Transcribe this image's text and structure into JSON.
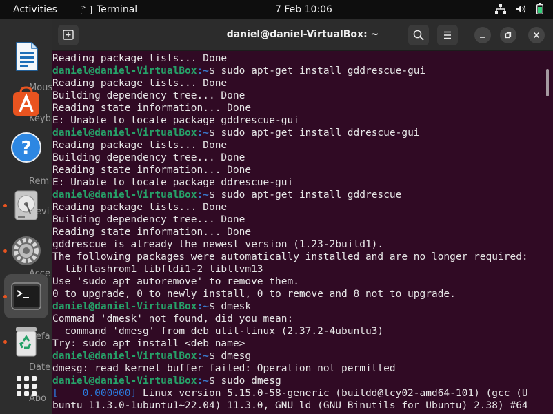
{
  "topbar": {
    "activities": "Activities",
    "app_name": "Terminal",
    "clock": "7 Feb  10:06"
  },
  "dock": {
    "background_labels": [
      "Mous",
      "Keyb",
      "Rem",
      "Devi",
      "Acce",
      "Defa",
      "Date",
      "Abo"
    ],
    "items": [
      {
        "name": "libreoffice-writer-icon"
      },
      {
        "name": "app-center-icon"
      },
      {
        "name": "help-icon"
      },
      {
        "name": "disks-icon"
      },
      {
        "name": "settings-icon"
      },
      {
        "name": "terminal-icon"
      },
      {
        "name": "trash-icon"
      },
      {
        "name": "show-apps-icon"
      }
    ]
  },
  "window": {
    "title": "daniel@daniel-VirtualBox: ~"
  },
  "terminal": {
    "prompt_user": "daniel@daniel-VirtualBox",
    "prompt_path": ":~",
    "prompt_symbol": "$ ",
    "lines": [
      {
        "type": "out",
        "text": "Reading package lists... Done"
      },
      {
        "type": "cmd",
        "text": "sudo apt-get install gddrescue-gui"
      },
      {
        "type": "out",
        "text": "Reading package lists... Done"
      },
      {
        "type": "out",
        "text": "Building dependency tree... Done"
      },
      {
        "type": "out",
        "text": "Reading state information... Done"
      },
      {
        "type": "out",
        "text": "E: Unable to locate package gddrescue-gui"
      },
      {
        "type": "cmd",
        "text": "sudo apt-get install ddrescue-gui"
      },
      {
        "type": "out",
        "text": "Reading package lists... Done"
      },
      {
        "type": "out",
        "text": "Building dependency tree... Done"
      },
      {
        "type": "out",
        "text": "Reading state information... Done"
      },
      {
        "type": "out",
        "text": "E: Unable to locate package ddrescue-gui"
      },
      {
        "type": "cmd",
        "text": "sudo apt-get install gddrescue"
      },
      {
        "type": "out",
        "text": "Reading package lists... Done"
      },
      {
        "type": "out",
        "text": "Building dependency tree... Done"
      },
      {
        "type": "out",
        "text": "Reading state information... Done"
      },
      {
        "type": "out",
        "text": "gddrescue is already the newest version (1.23-2build1)."
      },
      {
        "type": "out",
        "text": "The following packages were automatically installed and are no longer required:"
      },
      {
        "type": "out",
        "text": "  libflashrom1 libftdi1-2 libllvm13"
      },
      {
        "type": "out",
        "text": "Use 'sudo apt autoremove' to remove them."
      },
      {
        "type": "out",
        "text": "0 to upgrade, 0 to newly install, 0 to remove and 8 not to upgrade."
      },
      {
        "type": "cmd",
        "text": "dmesk"
      },
      {
        "type": "out",
        "text": "Command 'dmesk' not found, did you mean:"
      },
      {
        "type": "out",
        "text": "  command 'dmesg' from deb util-linux (2.37.2-4ubuntu3)"
      },
      {
        "type": "out",
        "text": "Try: sudo apt install <deb name>"
      },
      {
        "type": "cmd",
        "text": "dmesg"
      },
      {
        "type": "out",
        "text": "dmesg: read kernel buffer failed: Operation not permitted"
      },
      {
        "type": "cmd",
        "text": "sudo dmesg"
      },
      {
        "type": "dmesg",
        "ts": "[    0.000000]",
        "text": " Linux version 5.15.0-58-generic (buildd@lcy02-amd64-101) (gcc (U"
      },
      {
        "type": "out",
        "text": "buntu 11.3.0-1ubuntu1~22.04) 11.3.0, GNU ld (GNU Binutils for Ubuntu) 2.38) #64"
      }
    ]
  },
  "colors": {
    "terminal_bg": "#300a24",
    "prompt_user": "#26a269",
    "prompt_path": "#3a77c9",
    "accent": "#e95420"
  }
}
